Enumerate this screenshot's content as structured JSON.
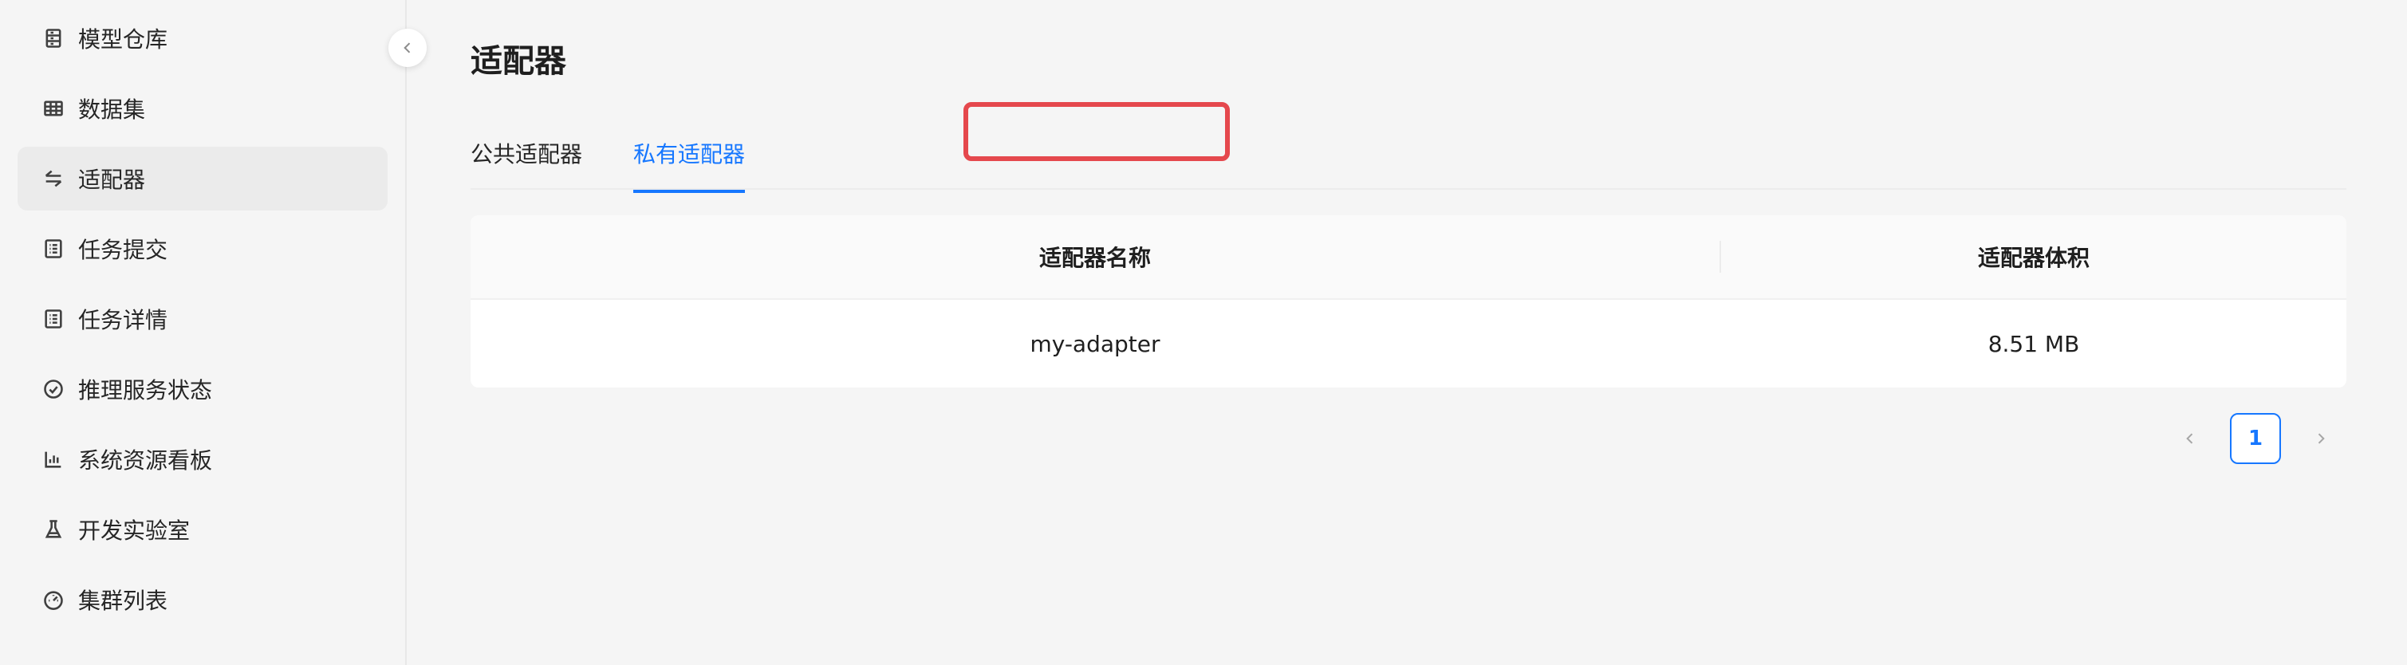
{
  "sidebar": {
    "items": [
      {
        "label": "模型仓库",
        "icon": "model-repo-icon"
      },
      {
        "label": "数据集",
        "icon": "table-icon"
      },
      {
        "label": "适配器",
        "icon": "swap-icon"
      },
      {
        "label": "任务提交",
        "icon": "task-list-icon"
      },
      {
        "label": "任务详情",
        "icon": "task-detail-icon"
      },
      {
        "label": "推理服务状态",
        "icon": "check-circle-icon"
      },
      {
        "label": "系统资源看板",
        "icon": "bar-chart-icon"
      },
      {
        "label": "开发实验室",
        "icon": "flask-icon"
      },
      {
        "label": "集群列表",
        "icon": "dashboard-icon"
      }
    ],
    "active_index": 2
  },
  "page": {
    "title": "适配器"
  },
  "tabs": [
    {
      "label": "公共适配器",
      "active": false
    },
    {
      "label": "私有适配器",
      "active": true
    }
  ],
  "table": {
    "columns": [
      "适配器名称",
      "适配器体积"
    ],
    "rows": [
      {
        "name": "my-adapter",
        "size": "8.51 MB"
      }
    ]
  },
  "pagination": {
    "current_page": "1"
  },
  "colors": {
    "accent": "#1677ff",
    "highlight": "#e5484d"
  }
}
